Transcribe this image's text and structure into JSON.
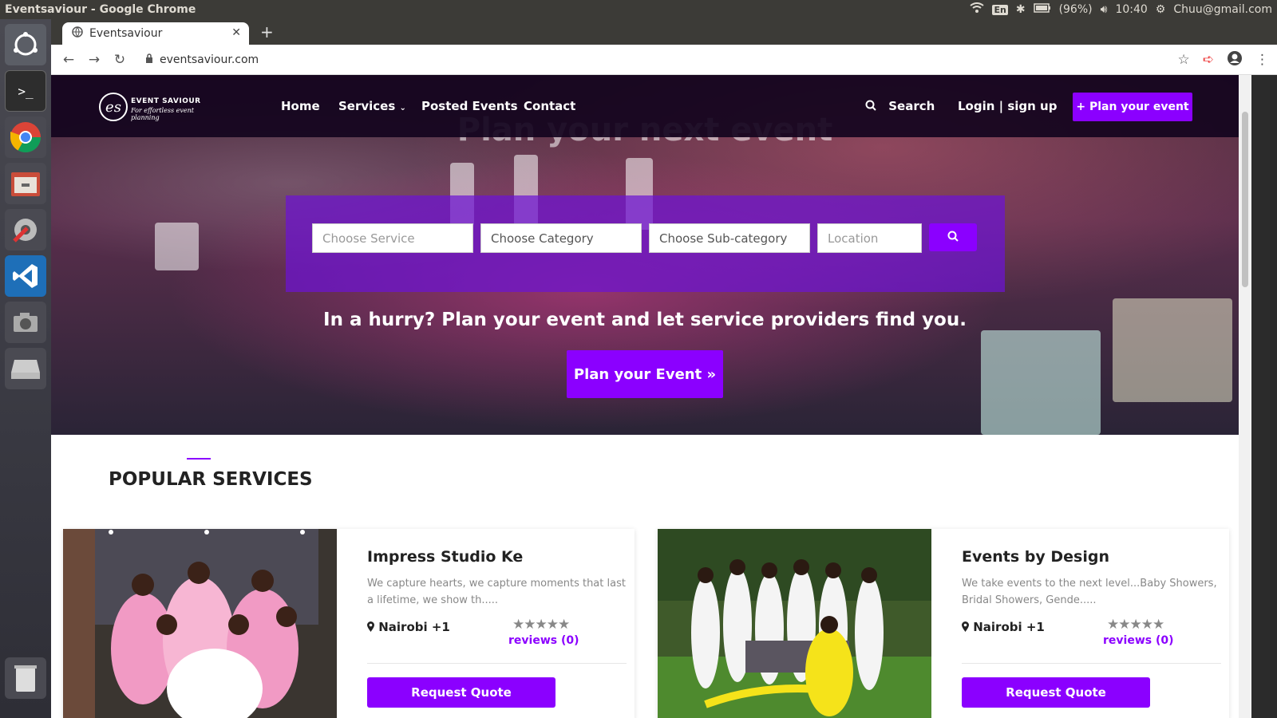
{
  "os": {
    "window_title": "Eventsaviour - Google Chrome",
    "lang": "En",
    "battery": "(96%)",
    "time": "10:40",
    "user": "Chuu@gmail.com"
  },
  "browser": {
    "tab_title": "Eventsaviour",
    "url": "eventsaviour.com"
  },
  "site": {
    "logo_text": "EVENT SAVIOUR",
    "logo_tagline": "For effortless event planning",
    "logo_mark": "es",
    "nav": {
      "home": "Home",
      "services": "Services",
      "posted_events": "Posted Events",
      "contact": "Contact",
      "search": "Search",
      "login": "Login | sign up",
      "plan_event": "+ Plan your event"
    },
    "hero": {
      "heading": "Plan your next event",
      "choose_service": "Choose Service",
      "choose_category": "Choose Category",
      "choose_subcategory": "Choose Sub-category",
      "location": "Location",
      "hurry_text": "In a hurry? Plan your event and let service providers find you.",
      "plan_button": "Plan your Event »"
    },
    "popular": {
      "title": "POPULAR SERVICES",
      "cards": [
        {
          "name": "Impress Studio Ke",
          "description": "We capture hearts, we capture moments that last a lifetime, we show th.....",
          "location": "Nairobi +1",
          "stars": "★★★★★",
          "reviews": "reviews (0)",
          "button": "Request Quote"
        },
        {
          "name": "Events by Design",
          "description": "We take events to the next level...Baby Showers, Bridal Showers, Gende.....",
          "location": "Nairobi +1",
          "stars": "★★★★★",
          "reviews": "reviews (0)",
          "button": "Request Quote"
        }
      ]
    }
  },
  "colors": {
    "accent": "#8b00ff",
    "nav_bg": "#14041e"
  }
}
